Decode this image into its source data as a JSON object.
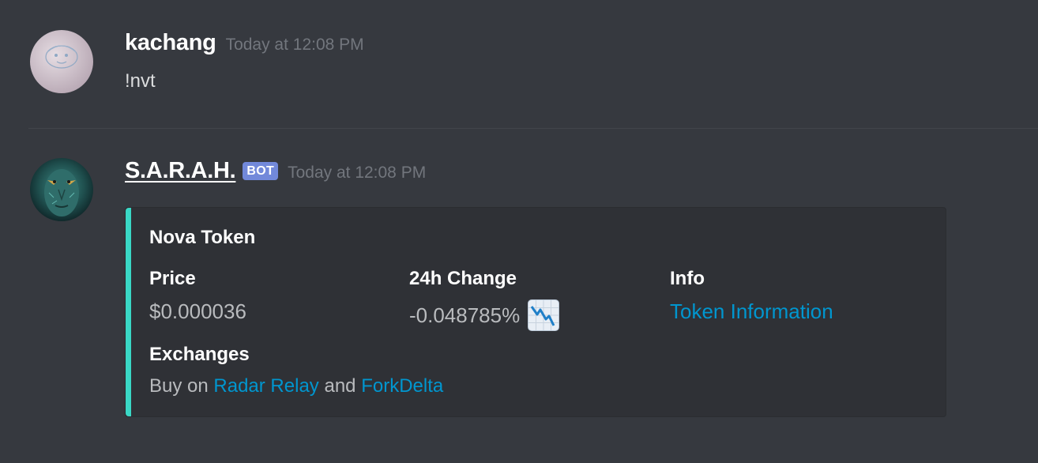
{
  "messages": [
    {
      "username": "kachang",
      "timestamp": "Today at 12:08 PM",
      "content": "!nvt"
    },
    {
      "username": "S.A.R.A.H.",
      "bot_tag": "BOT",
      "timestamp": "Today at 12:08 PM",
      "embed": {
        "accent_color": "#3ad8c6",
        "title": "Nova Token",
        "fields": [
          {
            "name": "Price",
            "value": "$0.000036"
          },
          {
            "name": "24h Change",
            "value": "-0.048785%",
            "icon": "chart-decreasing-icon"
          },
          {
            "name": "Info",
            "link": "Token Information"
          }
        ],
        "exchanges": {
          "name": "Exchanges",
          "prefix": "Buy on",
          "link1": "Radar Relay",
          "conjunction": "and",
          "link2": "ForkDelta"
        }
      }
    }
  ],
  "colors": {
    "background": "#36393f",
    "embed_background": "#2f3136",
    "link": "#0096cf",
    "bot_tag": "#7289da"
  }
}
